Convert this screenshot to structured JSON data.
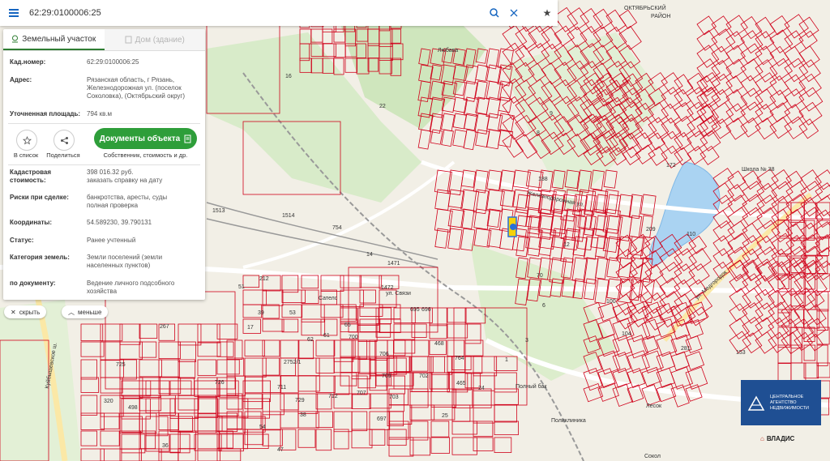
{
  "search": {
    "value": "62:29:0100006:25"
  },
  "tabs": {
    "land": "Земельный участок",
    "building": "Дом (здание)"
  },
  "details": [
    {
      "label": "Кад.номер:",
      "value": "62:29:0100006:25",
      "link": true
    },
    {
      "label": "Адрес:",
      "value": "Рязанская область, г Рязань, Железнодорожная ул. (поселок Соколовка), (Октябрьский округ)"
    },
    {
      "label": "Уточненная площадь:",
      "value": "794 кв.м"
    }
  ],
  "actions": {
    "favorite": "В список",
    "share": "Поделиться",
    "docs_button": "Документы объекта",
    "docs_sub": "Собственник, стоимость и др."
  },
  "details2": [
    {
      "label": "Кадастровая стоимость:",
      "value": "398 016.32 руб.",
      "link_text": "заказать справку на дату"
    },
    {
      "label": "Риски при сделке:",
      "value": "банкротства, аресты, суды",
      "link_text": "полная проверка"
    },
    {
      "label": "Координаты:",
      "value": "54.589230, 39.790131"
    },
    {
      "label": "Статус:",
      "value": "Ранее учтенный"
    },
    {
      "label": "Категория земель:",
      "value": "Земли поселений (земли населенных пунктов)"
    },
    {
      "label": "по документу:",
      "value": "Ведение личного подсобного хозяйства"
    }
  ],
  "controls": {
    "hide": "скрыть",
    "less": "меньше"
  },
  "logo": {
    "line1": "ЦЕНТРАЛЬНОЕ",
    "line2": "АГЕНТСТВО",
    "line3": "НЕДВИЖИМОСТИ",
    "brand": "ВЛАДИС"
  },
  "map_labels": {
    "district": "ОКТЯБРЬСКИЙ РАЙОН",
    "district_line1": "ОКТЯБРЬСКИЙ",
    "district_line2": "РАЙОН",
    "street_svyazi": "ул. Связи",
    "street_zheleznodor": "Железнодорожная ул.",
    "street_medgorodok": "ул. Медгородок",
    "street_kuibyshev": "Куйбышевское ш.",
    "place_satelc": "Сателс",
    "place_polny_bak": "Полный бак",
    "place_lesok": "Лесок",
    "place_sokol": "Сокол",
    "place_school": "Школа № 38",
    "place_polyclinic": "Поликлиника",
    "place_lyubava": "Любава",
    "parcel_numbers": [
      "16",
      "22",
      "14",
      "754",
      "1514",
      "1513",
      "1471",
      "1472",
      "695",
      "696",
      "709",
      "702",
      "707",
      "703",
      "712",
      "726",
      "697",
      "2752/1",
      "725",
      "320",
      "498",
      "36",
      "54",
      "38",
      "47",
      "25",
      "24",
      "706",
      "468",
      "465",
      "764",
      "1",
      "3",
      "6",
      "8",
      "9",
      "110",
      "172",
      "104",
      "100",
      "153",
      "281",
      "188",
      "209",
      "12",
      "70",
      "65",
      "61",
      "62",
      "700",
      "17",
      "39",
      "51",
      "53",
      "212",
      "267",
      "729",
      "711"
    ]
  },
  "colors": {
    "accent": "#2e9e3a",
    "parcel": "#d0021b",
    "link": "#1565c0",
    "logo": "#1f4f93"
  }
}
